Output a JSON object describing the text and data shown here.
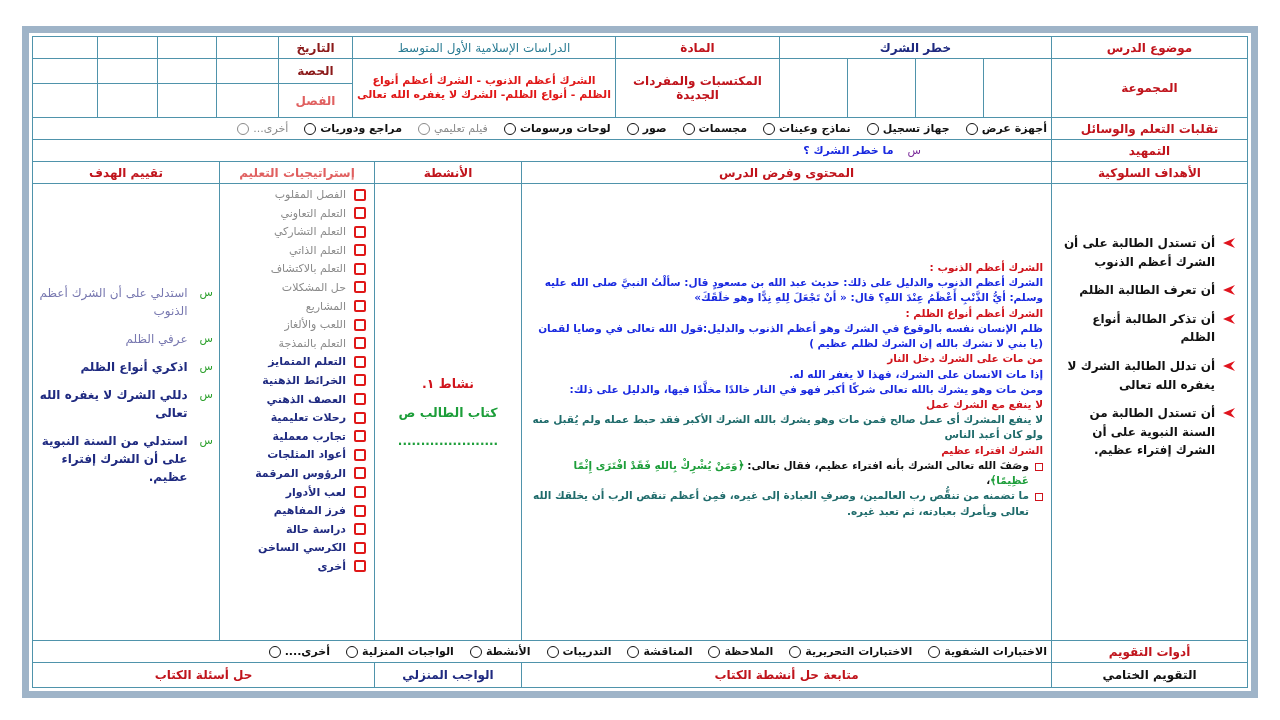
{
  "header": {
    "lesson_topic_label": "موضوع الدرس",
    "lesson_topic": "خطر الشرك",
    "subject_label": "المادة",
    "subject": "الدراسات الإسلامية الأول المتوسط",
    "date_label": "التاريخ",
    "group_label": "المجموعة",
    "vocabulary_label": "المكتسبات والمفردات الجديدة",
    "vocabulary": "الشرك أعظم الذنوب - الشرك أعظم أنواع الظلم - أنواع الظلم- الشرك لا يغفره الله تعالى",
    "period_label": "الحصة",
    "class_label": "الفصل"
  },
  "learning_resources": {
    "label": "تقلبات التعلم والوسائل",
    "options": [
      {
        "label": "أجهزة عرض",
        "checked": false,
        "dimmed": false
      },
      {
        "label": "جهاز تسجيل",
        "checked": false,
        "dimmed": false
      },
      {
        "label": "نماذج وعينات",
        "checked": false,
        "dimmed": false
      },
      {
        "label": "مجسمات",
        "checked": false,
        "dimmed": false
      },
      {
        "label": "صور",
        "checked": false,
        "dimmed": false
      },
      {
        "label": "لوحات ورسومات",
        "checked": false,
        "dimmed": false
      },
      {
        "label": "فيلم تعليمي",
        "checked": false,
        "dimmed": true
      },
      {
        "label": "مراجع ودوريات",
        "checked": false,
        "dimmed": false
      },
      {
        "label": "أخرى...",
        "checked": false,
        "dimmed": true
      }
    ]
  },
  "warm_up": {
    "label": "التمهيد",
    "marker": "س",
    "question": "ما خطر الشرك ؟"
  },
  "columns": {
    "objectives": "الأهداف السلوكية",
    "content": "المحتوى وفرض الدرس",
    "activities": "الأنشطة",
    "strategies": "إستراتيجيات التعليم",
    "assessment": "تقييم الهدف"
  },
  "objectives": [
    "أن تستدل الطالبة على أن الشرك أعظم الذنوب",
    "أن تعرف الطالبة الظلم",
    "أن تذكر الطالبة أنواع الظلم",
    "أن تدلل الطالبة الشرك لا يغفره الله تعالى",
    "أن تستدل الطالبة من السنة النبوية على أن الشرك إفتراء عظيم."
  ],
  "content": [
    {
      "kind": "heading",
      "text": "الشرك أعظم الذنوب :"
    },
    {
      "kind": "text",
      "text": "الشرك أعظم الذنوب والدليل على ذلك: حديث عبد الله بن مسعودٍ قال: سألْتُ النبيَّ صلى الله عليه وسلم: أيُّ الذَّنْبِ أَعْظَمُ عِنْدَ اللهِ؟ قال: « أنْ تَجْعَلَ لِلهِ نِدًّا وهو خلَقَكَ»"
    },
    {
      "kind": "heading",
      "text": "الشرك أعظم أنواع الظلم :"
    },
    {
      "kind": "text",
      "text": "ظلم الإنسان نفسه بالوقوع في الشرك وهو أعظم الذنوب والدليل:قول الله تعالى في وصايا لقمان (يا بني لا تشرك بالله إن الشرك لظلم عظيم )"
    },
    {
      "kind": "heading",
      "text": "من مات على الشرك دخل النار"
    },
    {
      "kind": "text",
      "text": "إذا مات الانسان على الشرك، فهذا لا يغفر الله له."
    },
    {
      "kind": "text",
      "text": "ومن مات وهو يشرك بالله تعالى شركًا أكبر فهو في النار خالدًا مخلَّدًا فيها، والدليل على ذلك:"
    },
    {
      "kind": "heading",
      "text": "لا ينفع مع الشرك عمل"
    },
    {
      "kind": "note",
      "text": "لا ينفع المشرك أى عمل صالح فمن مات وهو يشرك بالله الشرك الأكبر فقد حبط عمله ولم يُقبل منه ولو كان أعبد الناس"
    },
    {
      "kind": "heading",
      "text": "الشرك افتراء عظيم"
    },
    {
      "kind": "bullet",
      "parts": [
        {
          "kind": "plain",
          "text": "وصَفَ الله تعالى الشرك بأنه افتراء عظيم، فقال تعالى: "
        },
        {
          "kind": "verse",
          "text": "﴿وَمَنْ يُشْرِكْ بِاللهِ فَقَدْ افْتَرَى إِثْمًا عَظِيمًا﴾"
        },
        {
          "kind": "plain",
          "text": "،"
        }
      ]
    },
    {
      "kind": "bullet",
      "parts": [
        {
          "kind": "note",
          "text": "ما تضمنه من تنقُّص رب العالمين، وصرفِ العبادة إلى غيره، فمِن أعظم تنقص الرب أن يخلقك الله تعالى ويأمرك بعبادته، ثم تعبد غيره."
        }
      ]
    }
  ],
  "activities": {
    "title": "نشاط ١.",
    "book": "كتاب الطالب ص",
    "blank": "......................"
  },
  "strategies": [
    {
      "label": "الفصل المقلوب",
      "checked": false,
      "dimmed": true
    },
    {
      "label": "التعلم التعاوني",
      "checked": false,
      "dimmed": true
    },
    {
      "label": "التعلم التشاركي",
      "checked": false,
      "dimmed": true
    },
    {
      "label": "التعلم الذاتي",
      "checked": false,
      "dimmed": true
    },
    {
      "label": "التعلم بالاكتشاف",
      "checked": false,
      "dimmed": true
    },
    {
      "label": "حل المشكلات",
      "checked": false,
      "dimmed": true
    },
    {
      "label": "المشاريع",
      "checked": false,
      "dimmed": true
    },
    {
      "label": "اللعب والألغاز",
      "checked": false,
      "dimmed": true
    },
    {
      "label": "التعلم بالنمذجة",
      "checked": false,
      "dimmed": true
    },
    {
      "label": "التعلم المتمايز",
      "checked": false,
      "dimmed": false
    },
    {
      "label": "الخرائط الذهنية",
      "checked": false,
      "dimmed": false
    },
    {
      "label": "العصف الذهني",
      "checked": false,
      "dimmed": false
    },
    {
      "label": "رحلات تعليمية",
      "checked": false,
      "dimmed": false
    },
    {
      "label": "تجارب معملية",
      "checked": false,
      "dimmed": false
    },
    {
      "label": "أعواد المثلجات",
      "checked": false,
      "dimmed": false
    },
    {
      "label": "الرؤوس المرقمة",
      "checked": false,
      "dimmed": false
    },
    {
      "label": "لعب الأدوار",
      "checked": false,
      "dimmed": false
    },
    {
      "label": "فرز المفاهيم",
      "checked": false,
      "dimmed": false
    },
    {
      "label": "دراسة حالة",
      "checked": false,
      "dimmed": false
    },
    {
      "label": "الكرسي الساخن",
      "checked": false,
      "dimmed": false
    },
    {
      "label": "أخرى",
      "checked": false,
      "dimmed": false
    }
  ],
  "assessment": [
    {
      "marker": "س",
      "text": "استدلي على أن الشرك أعظم الذنوب",
      "dimmed": true
    },
    {
      "marker": "س",
      "text": "عرفي الظلم",
      "dimmed": true
    },
    {
      "marker": "س",
      "text": "اذكري أنواع الظلم",
      "dimmed": false
    },
    {
      "marker": "س",
      "text": "دللي الشرك لا يغفره الله تعالى",
      "dimmed": false
    },
    {
      "marker": "س",
      "text": "استدلي من السنة النبوية على أن الشرك إفتراء عظيم.",
      "dimmed": false
    }
  ],
  "evaluation_tools": {
    "label": "أدوات التقويم",
    "options": [
      {
        "label": "الاختبارات الشفوية",
        "checked": false
      },
      {
        "label": "الاختبارات التحريرية",
        "checked": false
      },
      {
        "label": "الملاحظة",
        "checked": false
      },
      {
        "label": "المناقشة",
        "checked": false
      },
      {
        "label": "التدريبات",
        "checked": false
      },
      {
        "label": "الأنشطة",
        "checked": false
      },
      {
        "label": "الواجبات المنزلية",
        "checked": false
      },
      {
        "label": "أخرى....",
        "checked": false
      }
    ]
  },
  "final": {
    "label": "التقويم الختامي",
    "follow_up": "متابعة حل أنشطة الكتاب",
    "homework_label": "الواجب المنزلي",
    "homework": "حل أسئلة الكتاب"
  }
}
